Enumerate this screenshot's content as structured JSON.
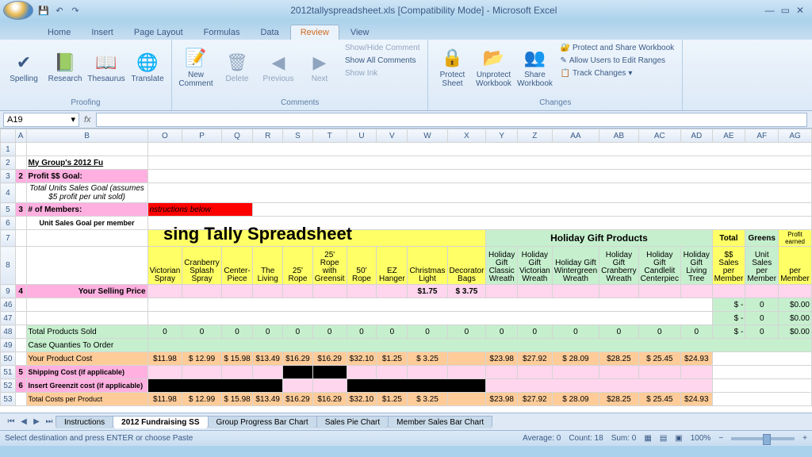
{
  "title": "2012tallyspreadsheet.xls  [Compatibility Mode] - Microsoft Excel",
  "tabs": [
    "Home",
    "Insert",
    "Page Layout",
    "Formulas",
    "Data",
    "Review",
    "View"
  ],
  "activeTab": "Review",
  "ribbon": {
    "proofing": {
      "label": "Proofing",
      "spelling": "Spelling",
      "research": "Research",
      "thesaurus": "Thesaurus",
      "translate": "Translate"
    },
    "comments": {
      "label": "Comments",
      "new": "New Comment",
      "delete": "Delete",
      "previous": "Previous",
      "next": "Next",
      "showhide": "Show/Hide Comment",
      "showall": "Show All Comments",
      "showink": "Show Ink"
    },
    "changes": {
      "label": "Changes",
      "protectSheet": "Protect Sheet",
      "unprotect": "Unprotect Workbook",
      "share": "Share Workbook",
      "protectShare": "Protect and Share Workbook",
      "allowEdit": "Allow Users to Edit Ranges",
      "track": "Track Changes"
    }
  },
  "namebox": "A19",
  "cols": [
    "A",
    "B",
    "O",
    "P",
    "Q",
    "R",
    "S",
    "T",
    "U",
    "V",
    "W",
    "X",
    "Y",
    "Z",
    "AA",
    "AB",
    "AC",
    "AD",
    "AE",
    "AF",
    "AG"
  ],
  "rows_top": [
    "1",
    "2",
    "3",
    "4",
    "5",
    "6",
    "7",
    "8",
    "9"
  ],
  "rows_bottom": [
    "46",
    "47",
    "48",
    "49",
    "50",
    "51",
    "52",
    "53"
  ],
  "content": {
    "r2b": "My Group's 2012 Fu",
    "r3a": "2",
    "r3b": "Profit $$ Goal:",
    "r4b": "Total Units Sales Goal\n(assumes $5 profit per unit sold)",
    "r5a": "3",
    "r5b": "# of Members:",
    "r5op": "nstructions below",
    "r6b": "Unit Sales Goal per member",
    "r6big": "sing Tally Spreadsheet",
    "r7center": "Holiday Gift Products",
    "r7ae": "Total",
    "r7af": "Greens",
    "r7ag": "Profit earned",
    "headers": [
      "Victorian Spray",
      "Cranberry Splash Spray",
      "Center-Piece",
      "The Living",
      "25' Rope",
      "25' Rope with Greensit",
      "50' Rope",
      "EZ Hanger",
      "Christmas Light",
      "Decorator Bags",
      "Holiday Gift Classic Wreath",
      "Holiday Gift Victorian Wreath",
      "Holiday Gift Wintergreen Wreath",
      "Holiday Gift Cranberry Wreath",
      "Holiday Gift Candlelit Centerpiec",
      "Holiday Gift Living Tree",
      "$$ Sales per Member",
      "Unit Sales per Member",
      "per Member"
    ],
    "r9a": "4",
    "r9b": "Your Selling Price",
    "r9w": "$1.75",
    "r9x": "$ 3.75",
    "r46ae": "$     -",
    "r46af": "0",
    "r46ag": "$0.00",
    "r47ae": "$     -",
    "r47af": "0",
    "r47ag": "$0.00",
    "r48b": "Total Products Sold",
    "r48vals": [
      "0",
      "0",
      "0",
      "0",
      "0",
      "0",
      "0",
      "0",
      "0",
      "0",
      "0",
      "0",
      "0",
      "0",
      "0",
      "0"
    ],
    "r48ae": "$     -",
    "r48af": "0",
    "r48ag": "$0.00",
    "r49b": "Case Quanties To Order",
    "r50b": "Your Product Cost",
    "r50vals": [
      "$11.98",
      "$ 12.99",
      "$ 15.98",
      "$13.49",
      "$16.29",
      "$16.29",
      "$32.10",
      "$1.25",
      "$ 3.25",
      "",
      "$23.98",
      "$27.92",
      "$ 28.09",
      "$28.25",
      "$ 25.45",
      "$24.93"
    ],
    "r51a": "5",
    "r51b": "Shipping Cost (if applicable)",
    "r52a": "6",
    "r52b": "Insert Greenzit cost (if applicable)",
    "r53b": "Total Costs per Product",
    "r53vals": [
      "$11.98",
      "$ 12.99",
      "$ 15.98",
      "$13.49",
      "$16.29",
      "$16.29",
      "$32.10",
      "$1.25",
      "$ 3.25",
      "",
      "$23.98",
      "$27.92",
      "$ 28.09",
      "$28.25",
      "$ 25.45",
      "$24.93"
    ]
  },
  "sheetTabs": [
    "Instructions",
    "2012 Fundraising SS",
    "Group Progress Bar Chart",
    "Sales Pie Chart",
    "Member Sales Bar Chart"
  ],
  "activeSheet": 1,
  "status": {
    "left": "Select destination and press ENTER or choose Paste",
    "avg": "Average: 0",
    "count": "Count: 18",
    "sum": "Sum: 0",
    "zoom": "100%"
  }
}
